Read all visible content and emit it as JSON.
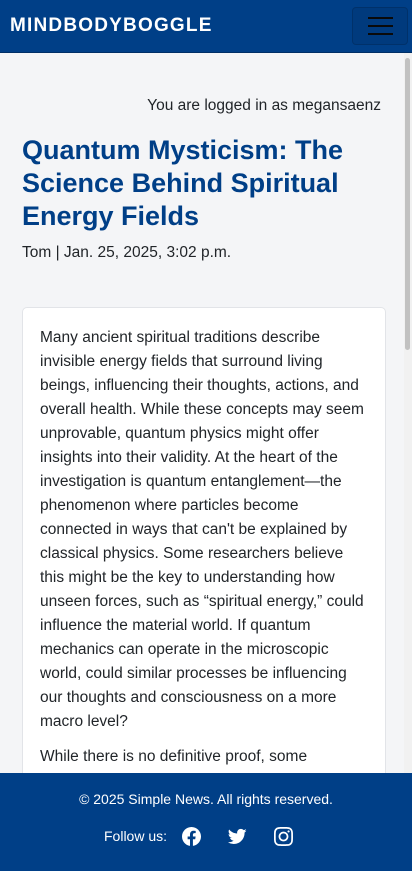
{
  "navbar": {
    "brand": "MINDBODYBOGGLE",
    "menu_icon": "hamburger-menu-icon"
  },
  "session": {
    "login_status": "You are logged in as megansaenz"
  },
  "article": {
    "title": "Quantum Mysticism: The Science Behind Spiritual Energy Fields",
    "meta": "Tom | Jan. 25, 2025, 3:02 p.m.",
    "paragraphs": [
      "Many ancient spiritual traditions describe invisible energy fields that surround living beings, influencing their thoughts, actions, and overall health. While these concepts may seem unprovable, quantum physics might offer insights into their validity. At the heart of the investigation is quantum entanglement—the phenomenon where particles become connected in ways that can't be explained by classical physics. Some researchers believe this might be the key to understanding how unseen forces, such as “spiritual energy,” could influence the material world. If quantum mechanics can operate in the microscopic world, could similar processes be influencing our thoughts and consciousness on a more macro level?",
      "While there is no definitive proof, some"
    ]
  },
  "footer": {
    "copyright": "© 2025 Simple News. All rights reserved.",
    "follow_label": "Follow us:",
    "social_icons": [
      "facebook-icon",
      "twitter-icon",
      "instagram-icon"
    ]
  },
  "colors": {
    "brand_blue": "#003f87",
    "title_blue": "#003f87",
    "page_background": "#f4f5f7",
    "card_background": "#ffffff"
  }
}
